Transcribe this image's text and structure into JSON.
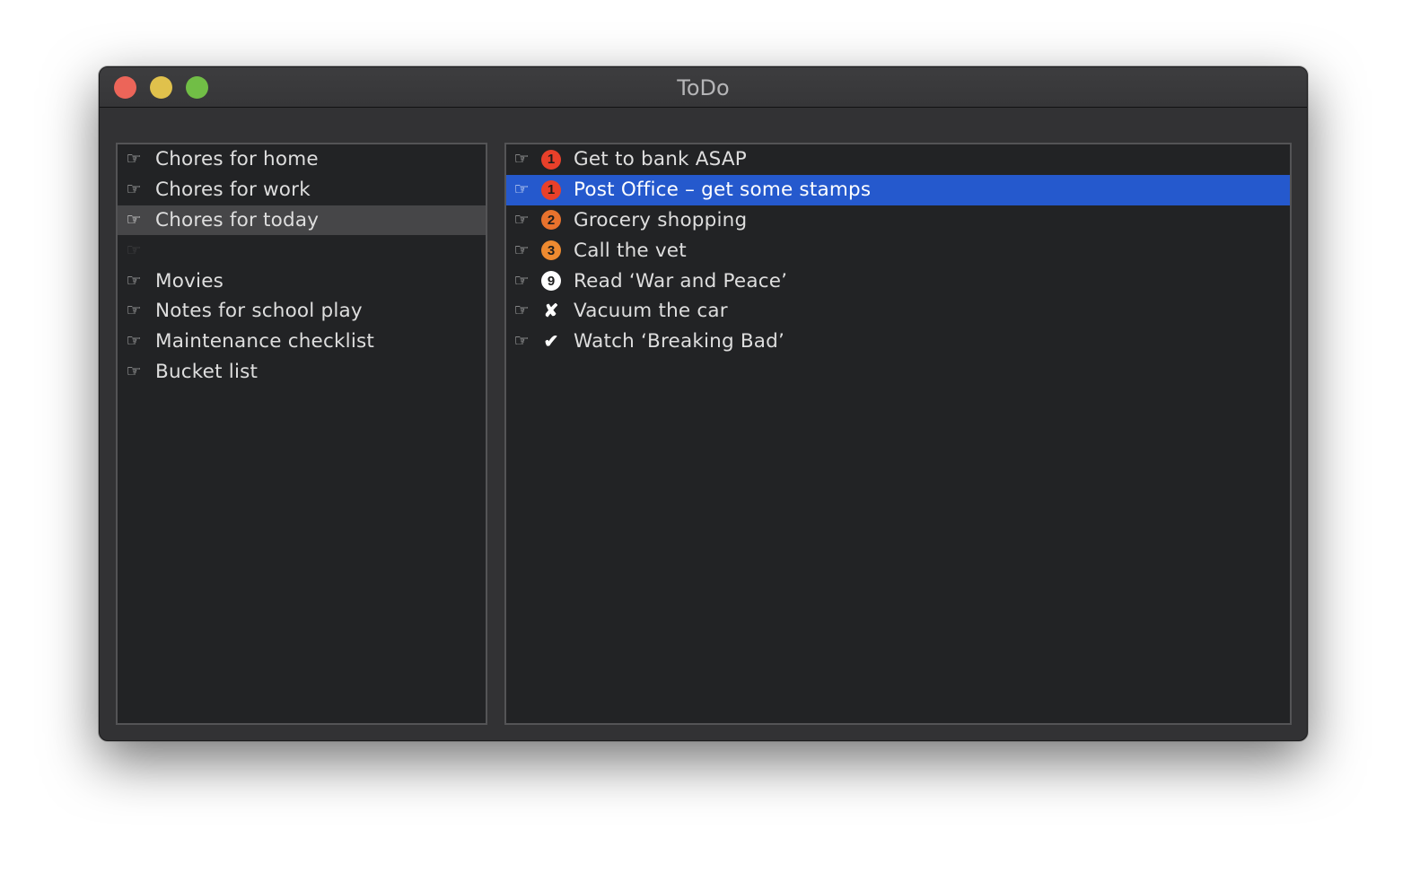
{
  "window": {
    "title": "ToDo",
    "controls": [
      "close",
      "minimize",
      "zoom"
    ]
  },
  "lists": {
    "selected_index": 2,
    "items": [
      {
        "icon": "hand-pointing-right-icon",
        "label": "Chores for home"
      },
      {
        "icon": "hand-pointing-right-icon",
        "label": "Chores for work"
      },
      {
        "icon": "hand-pointing-right-icon",
        "label": "Chores for today"
      },
      {
        "icon": "hand-pointing-right-icon",
        "label": ""
      },
      {
        "icon": "hand-pointing-right-icon",
        "label": "Movies"
      },
      {
        "icon": "hand-pointing-right-icon",
        "label": "Notes for school play"
      },
      {
        "icon": "hand-pointing-right-icon",
        "label": "Maintenance checklist"
      },
      {
        "icon": "hand-pointing-right-icon",
        "label": "Bucket list"
      }
    ]
  },
  "tasks": {
    "selected_index": 1,
    "items": [
      {
        "icon": "hand-pointing-right-icon",
        "status": "priority-1",
        "status_glyph": "1",
        "status_color": "#e8402a",
        "label": "Get to bank ASAP"
      },
      {
        "icon": "hand-pointing-right-icon",
        "status": "priority-1",
        "status_glyph": "1",
        "status_color": "#e8402a",
        "label": "Post Office – get some stamps"
      },
      {
        "icon": "hand-pointing-right-icon",
        "status": "priority-2",
        "status_glyph": "2",
        "status_color": "#e8722d",
        "label": "Grocery shopping"
      },
      {
        "icon": "hand-pointing-right-icon",
        "status": "priority-3",
        "status_glyph": "3",
        "status_color": "#ee8a30",
        "label": "Call the vet"
      },
      {
        "icon": "hand-pointing-right-icon",
        "status": "priority-9",
        "status_glyph": "9",
        "status_color": "#ffffff",
        "label": "Read ‘War and Peace’"
      },
      {
        "icon": "hand-pointing-right-icon",
        "status": "cancelled",
        "status_glyph": "✘",
        "status_color": "#ffffff",
        "label": "Vacuum the car"
      },
      {
        "icon": "hand-pointing-right-icon",
        "status": "done",
        "status_glyph": "✔",
        "status_color": "#ffffff",
        "label": "Watch ‘Breaking Bad’"
      }
    ]
  },
  "colors": {
    "selection_active": "#2559cd",
    "selection_inactive": "#464648",
    "panel_background": "#222325",
    "window_background": "#323234"
  }
}
